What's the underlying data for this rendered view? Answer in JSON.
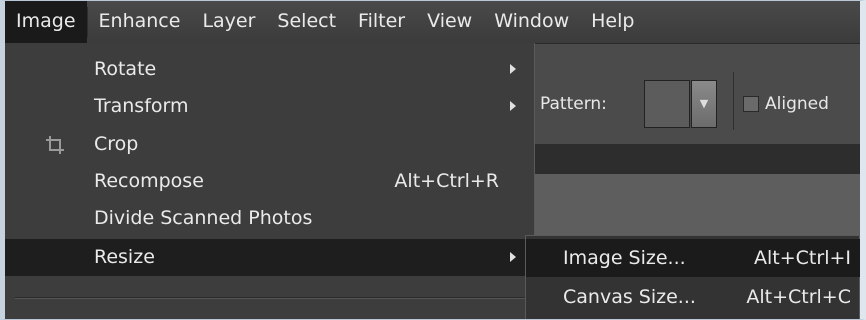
{
  "menubar": {
    "items": [
      "Image",
      "Enhance",
      "Layer",
      "Select",
      "Filter",
      "View",
      "Window",
      "Help"
    ]
  },
  "options": {
    "pattern_label": "Pattern:",
    "aligned_label": "Aligned"
  },
  "image_menu": {
    "items": [
      {
        "label": "Rotate",
        "shortcut": "",
        "submenu": true
      },
      {
        "label": "Transform",
        "shortcut": "",
        "submenu": true
      },
      {
        "label": "Crop",
        "shortcut": "",
        "submenu": false,
        "icon": "crop-icon"
      },
      {
        "label": "Recompose",
        "shortcut": "Alt+Ctrl+R",
        "submenu": false
      },
      {
        "label": "Divide Scanned Photos",
        "shortcut": "",
        "submenu": false
      },
      {
        "label": "Resize",
        "shortcut": "",
        "submenu": true,
        "highlighted": true
      }
    ]
  },
  "resize_submenu": {
    "items": [
      {
        "label": "Image Size...",
        "shortcut": "Alt+Ctrl+I",
        "highlighted": true
      },
      {
        "label": "Canvas Size...",
        "shortcut": "Alt+Ctrl+C"
      }
    ]
  }
}
